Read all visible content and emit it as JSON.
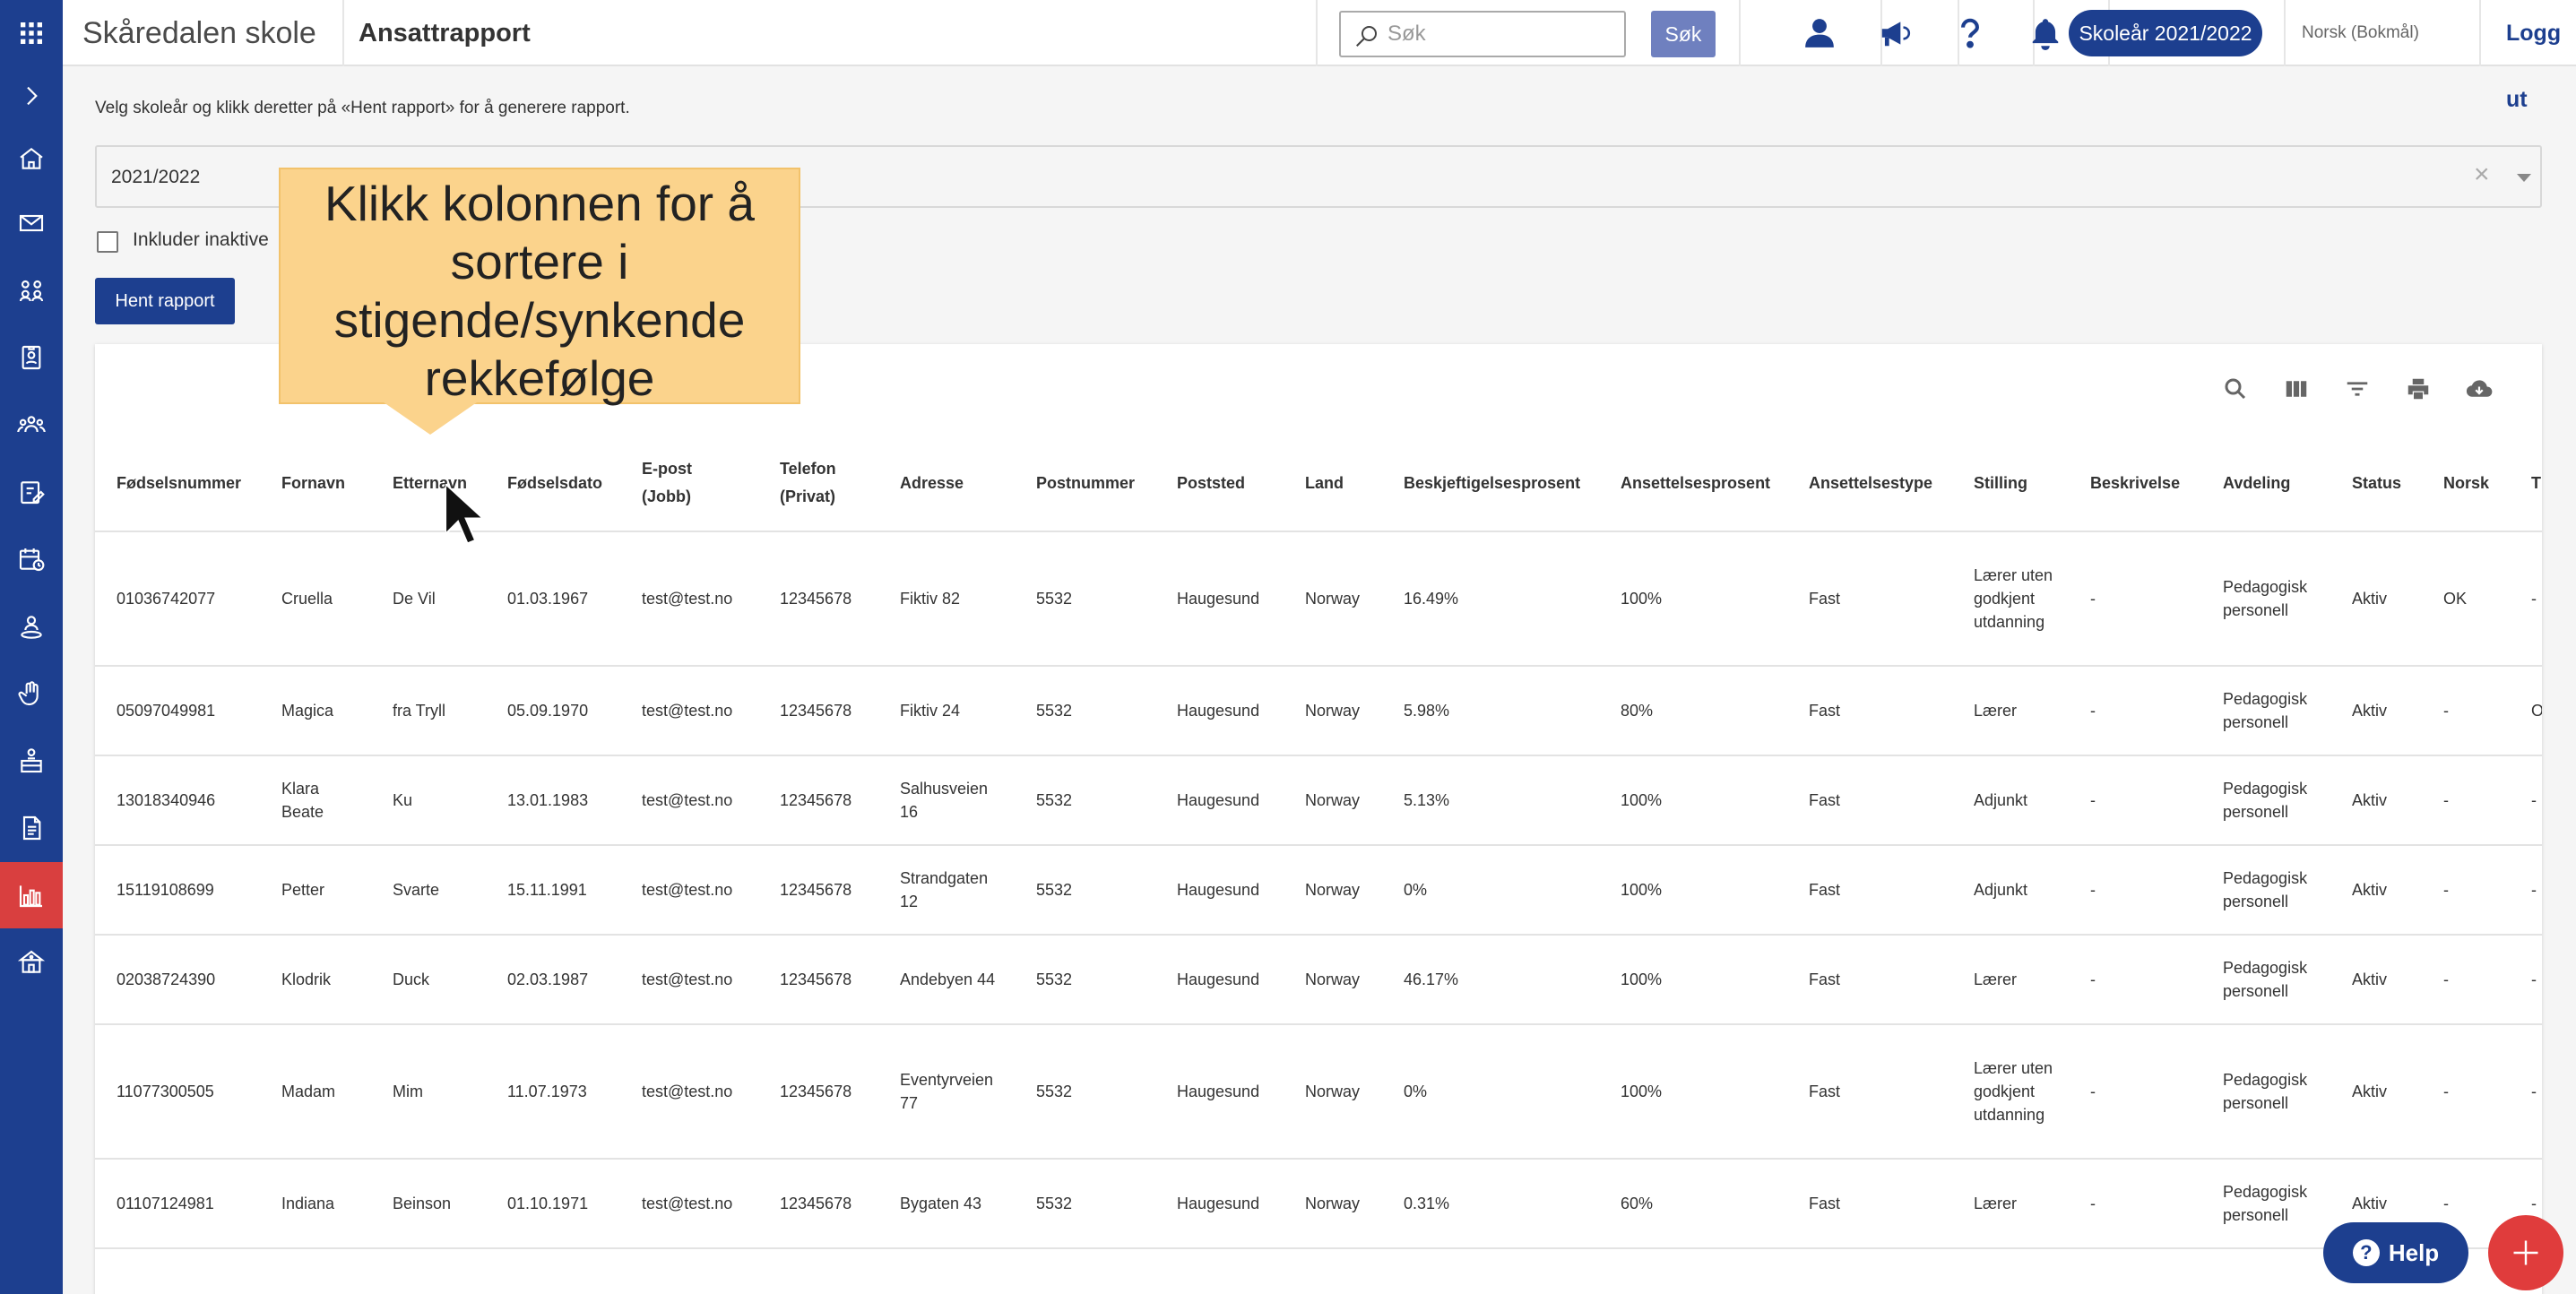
{
  "app": {
    "school_name": "Skåredalen skole",
    "page_title": "Ansattrapport"
  },
  "topbar": {
    "search_placeholder": "Søk",
    "search_button": "Søk",
    "school_year_button": "Skoleår 2021/2022",
    "language": "Norsk (Bokmål)",
    "logout": "Logg ut"
  },
  "filters": {
    "instruction": "Velg skoleår og klikk deretter på «Hent rapport» for å generere rapport.",
    "selected_year": "2021/2022",
    "include_inactive_label": "Inkluder inaktive",
    "fetch_button": "Hent rapport"
  },
  "tooltip": {
    "lines": [
      "Klikk kolonnen for å",
      "sortere i",
      "stigende/synkende",
      "rekkefølge"
    ]
  },
  "table": {
    "headers": [
      "Fødselsnummer",
      "Fornavn",
      "Etternavn",
      "Fødselsdato",
      "E-post (Jobb)",
      "Telefon (Privat)",
      "Adresse",
      "Postnummer",
      "Poststed",
      "Land",
      "Beskjeftigelsesprosent",
      "Ansettelsesprosent",
      "Ansettelsestype",
      "Stilling",
      "Beskrivelse",
      "Avdeling",
      "Status",
      "Norsk",
      "T"
    ],
    "rows": [
      [
        "01036742077",
        "Cruella",
        "De Vil",
        "01.03.1967",
        "test@test.no",
        "12345678",
        "Fiktiv 82",
        "5532",
        "Haugesund",
        "Norway",
        "16.49%",
        "100%",
        "Fast",
        "Lærer uten godkjent utdanning",
        "-",
        "Pedagogisk personell",
        "Aktiv",
        "OK",
        "-"
      ],
      [
        "05097049981",
        "Magica",
        "fra Tryll",
        "05.09.1970",
        "test@test.no",
        "12345678",
        "Fiktiv 24",
        "5532",
        "Haugesund",
        "Norway",
        "5.98%",
        "80%",
        "Fast",
        "Lærer",
        "-",
        "Pedagogisk personell",
        "Aktiv",
        "-",
        "O"
      ],
      [
        "13018340946",
        "Klara Beate",
        "Ku",
        "13.01.1983",
        "test@test.no",
        "12345678",
        "Salhusveien 16",
        "5532",
        "Haugesund",
        "Norway",
        "5.13%",
        "100%",
        "Fast",
        "Adjunkt",
        "-",
        "Pedagogisk personell",
        "Aktiv",
        "-",
        "-"
      ],
      [
        "15119108699",
        "Petter",
        "Svarte",
        "15.11.1991",
        "test@test.no",
        "12345678",
        "Strandgaten 12",
        "5532",
        "Haugesund",
        "Norway",
        "0%",
        "100%",
        "Fast",
        "Adjunkt",
        "-",
        "Pedagogisk personell",
        "Aktiv",
        "-",
        "-"
      ],
      [
        "02038724390",
        "Klodrik",
        "Duck",
        "02.03.1987",
        "test@test.no",
        "12345678",
        "Andebyen 44",
        "5532",
        "Haugesund",
        "Norway",
        "46.17%",
        "100%",
        "Fast",
        "Lærer",
        "-",
        "Pedagogisk personell",
        "Aktiv",
        "-",
        "-"
      ],
      [
        "11077300505",
        "Madam",
        "Mim",
        "11.07.1973",
        "test@test.no",
        "12345678",
        "Eventyrveien 77",
        "5532",
        "Haugesund",
        "Norway",
        "0%",
        "100%",
        "Fast",
        "Lærer uten godkjent utdanning",
        "-",
        "Pedagogisk personell",
        "Aktiv",
        "-",
        "-"
      ],
      [
        "01107124981",
        "Indiana",
        "Beinson",
        "01.10.1971",
        "test@test.no",
        "12345678",
        "Bygaten 43",
        "5532",
        "Haugesund",
        "Norway",
        "0.31%",
        "60%",
        "Fast",
        "Lærer",
        "-",
        "Pedagogisk personell",
        "Aktiv",
        "-",
        "-"
      ]
    ]
  },
  "floating": {
    "help_button": "Help"
  },
  "icons": {
    "sidebar": [
      "grid-icon",
      "expand-chevron-icon",
      "home-icon",
      "mail-icon",
      "people-icon",
      "badge-icon",
      "group-icon",
      "edit-document-icon",
      "schedule-icon",
      "person-pin-icon",
      "hand-icon",
      "podium-icon",
      "report-document-icon",
      "bar-chart-icon",
      "school-icon"
    ],
    "topbar": [
      "search-icon",
      "user-icon",
      "megaphone-icon",
      "help-icon",
      "bell-icon"
    ],
    "table_tools": [
      "search-icon",
      "columns-icon",
      "filter-icon",
      "print-icon",
      "download-icon"
    ]
  },
  "colors": {
    "primary": "#1d3f8f",
    "accent": "#e03c3c",
    "tooltip": "#fbd38c",
    "search_button": "#6f80bf"
  }
}
